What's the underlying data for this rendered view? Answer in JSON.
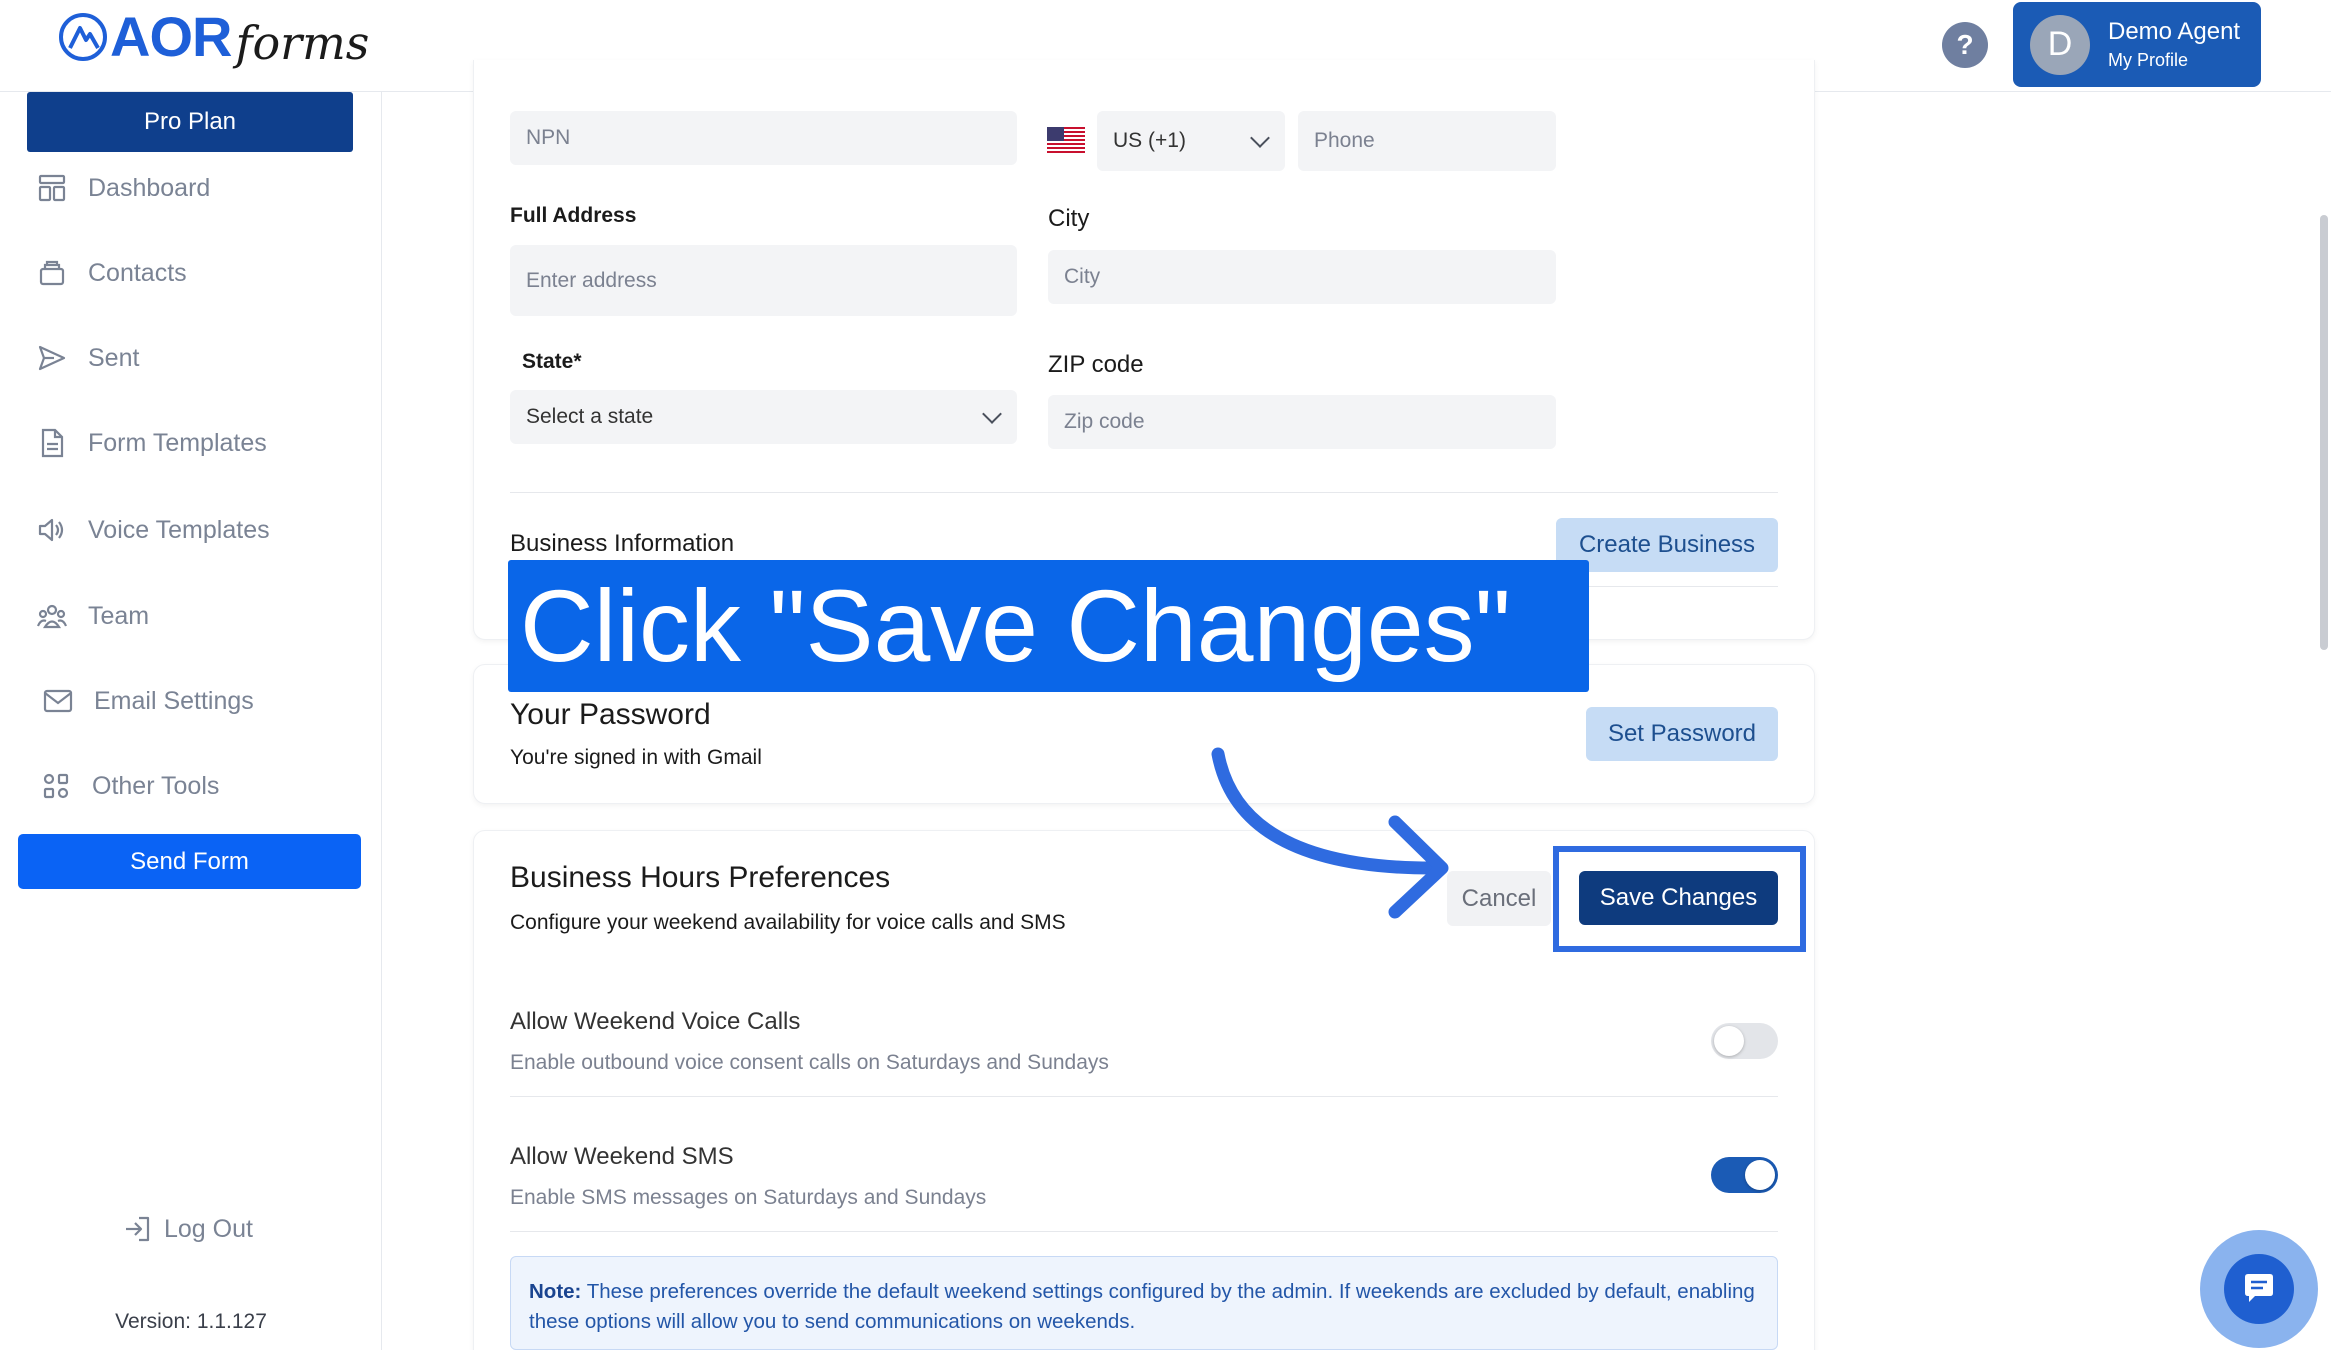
{
  "header": {
    "logo_aor": "AOR",
    "logo_forms": "forms",
    "help_label": "?",
    "profile": {
      "initial": "D",
      "name": "Demo Agent",
      "sub": "My Profile"
    }
  },
  "sidebar": {
    "plan": "Pro Plan",
    "items": [
      {
        "label": "Dashboard",
        "icon": "dashboard-icon"
      },
      {
        "label": "Contacts",
        "icon": "contacts-icon"
      },
      {
        "label": "Sent",
        "icon": "send-icon"
      },
      {
        "label": "Form Templates",
        "icon": "document-icon"
      },
      {
        "label": "Voice Templates",
        "icon": "speaker-icon"
      },
      {
        "label": "Team",
        "icon": "team-icon"
      },
      {
        "label": "Email Settings",
        "icon": "mail-icon"
      },
      {
        "label": "Other Tools",
        "icon": "grid-icon"
      }
    ],
    "send_form": "Send Form",
    "logout": "Log Out",
    "version": "Version: 1.1.127"
  },
  "profile_form": {
    "npn_placeholder": "NPN",
    "country_code": "US (+1)",
    "phone_placeholder": "Phone",
    "address_label": "Full Address",
    "address_placeholder": "Enter address",
    "city_label": "City",
    "city_placeholder": "City",
    "state_label": "State*",
    "state_placeholder": "Select a state",
    "zip_label": "ZIP code",
    "zip_placeholder": "Zip code"
  },
  "business": {
    "title": "Business Information",
    "create_button": "Create Business"
  },
  "callout": {
    "text": "Click \"Save Changes\""
  },
  "password": {
    "title": "Your Password",
    "subtitle": "You're signed in with Gmail",
    "button": "Set Password"
  },
  "hours": {
    "title": "Business Hours Preferences",
    "subtitle": "Configure your weekend availability for voice calls and SMS",
    "cancel": "Cancel",
    "save": "Save Changes",
    "prefs": [
      {
        "title": "Allow Weekend Voice Calls",
        "description": "Enable outbound voice consent calls on Saturdays and Sundays",
        "enabled": false
      },
      {
        "title": "Allow Weekend SMS",
        "description": "Enable SMS messages on Saturdays and Sundays",
        "enabled": true
      }
    ],
    "note_label": "Note:",
    "note_text": " These preferences override the default weekend settings configured by the admin. If weekends are excluded by default, enabling these options will allow you to send communications on weekends."
  },
  "colors": {
    "brand_blue": "#1e5fd8",
    "primary_dark": "#0e3b7e",
    "send_blue": "#0a63f5",
    "callout_blue": "#0a66e8",
    "highlight": "#2f6be0"
  }
}
